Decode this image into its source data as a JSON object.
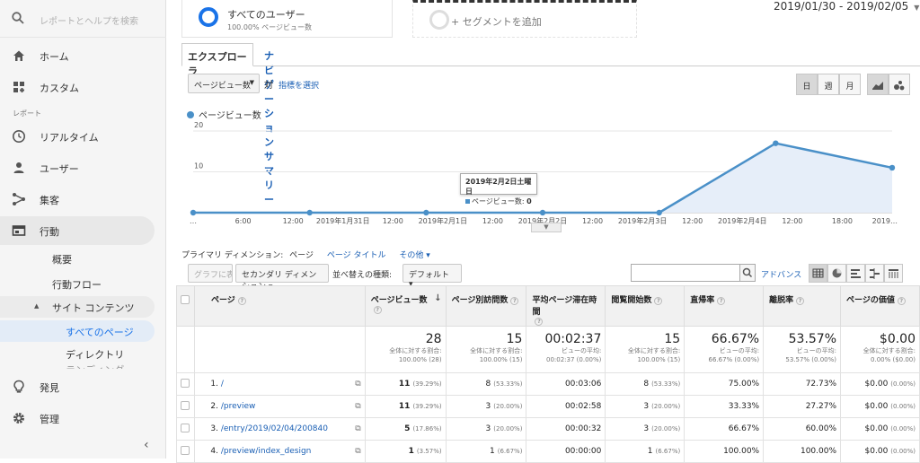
{
  "sidebar": {
    "search_placeholder": "レポートとヘルプを検索",
    "home": "ホーム",
    "custom": "カスタム",
    "reports_label": "レポート",
    "realtime": "リアルタイム",
    "users": "ユーザー",
    "acquisition": "集客",
    "behavior": "行動",
    "overview": "概要",
    "behavior_flow": "行動フロー",
    "site_content": "サイト コンテンツ",
    "site_content_arrow": "▲",
    "all_pages": "すべてのページ",
    "directory": "ディレクトリ",
    "landing_pages_cut": "ランディング",
    "discover": "発見",
    "admin": "管理",
    "collapse_glyph": "‹"
  },
  "segments": {
    "seg1_title": "すべてのユーザー",
    "seg1_sub": "100.00% ページビュー数",
    "seg2_title": "+ セグメントを追加"
  },
  "date_range": "2019/01/30 - 2019/02/05",
  "tabs": {
    "explorer": "エクスプローラ",
    "nav_summary": "ナビゲーション サマリー"
  },
  "controls": {
    "metric_select": "ページビュー数",
    "vs": "対",
    "pick_metric": "指標を選択",
    "day": "日",
    "week": "週",
    "month": "月"
  },
  "chart_data": {
    "type": "area",
    "legend": "ページビュー数",
    "ylim": [
      0,
      20
    ],
    "yticks": [
      10,
      20
    ],
    "x_labels": [
      "…",
      "6:00",
      "12:00",
      "2019年1月31日",
      "12:00",
      "2019年2月1日",
      "12:00",
      "2019年2月2日",
      "12:00",
      "2019年2月3日",
      "12:00",
      "2019年2月4日",
      "12:00",
      "18:00",
      "2019…"
    ],
    "points": [
      {
        "x": "2019年1月30日",
        "y": 0
      },
      {
        "x": "2019年1月31日",
        "y": 0
      },
      {
        "x": "2019年2月1日",
        "y": 0
      },
      {
        "x": "2019年2月2日",
        "y": 0
      },
      {
        "x": "2019年2月3日",
        "y": 0
      },
      {
        "x": "2019年2月4日",
        "y": 17
      },
      {
        "x": "2019年2月5日",
        "y": 11
      }
    ],
    "color": "#4a90c8",
    "grid": true,
    "tooltip": {
      "title": "2019年2月2日土曜日",
      "label": "ページビュー数:",
      "value": "0"
    }
  },
  "dimension": {
    "label": "プライマリ ディメンション:",
    "current": "ページ",
    "page_title": "ページ タイトル",
    "other": "その他 ▾"
  },
  "toolbar": {
    "plot_rows": "グラフに表示",
    "secondary_dim": "セカンダリ ディメンション ▾",
    "sort_label": "並べ替えの種類:",
    "sort_value": "デフォルト ▾",
    "advanced": "アドバンス"
  },
  "table": {
    "headers": [
      "ページ",
      "ページビュー数",
      "ページ別訪問数",
      "平均ページ滞在時間",
      "閲覧開始数",
      "直帰率",
      "離脱率",
      "ページの価値"
    ],
    "totals": [
      {
        "value": "28",
        "l1": "全体に対する割合:",
        "l2": "100.00% (28)"
      },
      {
        "value": "15",
        "l1": "全体に対する割合:",
        "l2": "100.00% (15)"
      },
      {
        "value": "00:02:37",
        "l1": "ビューの平均:",
        "l2": "00:02:37 (0.00%)"
      },
      {
        "value": "15",
        "l1": "全体に対する割合:",
        "l2": "100.00% (15)"
      },
      {
        "value": "66.67%",
        "l1": "ビューの平均:",
        "l2": "66.67% (0.00%)"
      },
      {
        "value": "53.57%",
        "l1": "ビューの平均:",
        "l2": "53.57% (0.00%)"
      },
      {
        "value": "$0.00",
        "l1": "全体に対する割合:",
        "l2": "0.00% ($0.00)"
      }
    ],
    "rows": [
      {
        "idx": "1.",
        "page": "/",
        "pv": "11",
        "pv_pct": "(39.29%)",
        "uv": "8",
        "uv_pct": "(53.33%)",
        "avg": "00:03:06",
        "ent": "8",
        "ent_pct": "(53.33%)",
        "bounce": "75.00%",
        "exit": "72.73%",
        "val": "$0.00",
        "val_pct": "(0.00%)"
      },
      {
        "idx": "2.",
        "page": "/preview",
        "pv": "11",
        "pv_pct": "(39.29%)",
        "uv": "3",
        "uv_pct": "(20.00%)",
        "avg": "00:02:58",
        "ent": "3",
        "ent_pct": "(20.00%)",
        "bounce": "33.33%",
        "exit": "27.27%",
        "val": "$0.00",
        "val_pct": "(0.00%)"
      },
      {
        "idx": "3.",
        "page": "/entry/2019/02/04/200840",
        "pv": "5",
        "pv_pct": "(17.86%)",
        "uv": "3",
        "uv_pct": "(20.00%)",
        "avg": "00:00:32",
        "ent": "3",
        "ent_pct": "(20.00%)",
        "bounce": "66.67%",
        "exit": "60.00%",
        "val": "$0.00",
        "val_pct": "(0.00%)"
      },
      {
        "idx": "4.",
        "page": "/preview/index_design",
        "pv": "1",
        "pv_pct": "(3.57%)",
        "uv": "1",
        "uv_pct": "(6.67%)",
        "avg": "00:00:00",
        "ent": "1",
        "ent_pct": "(6.67%)",
        "bounce": "100.00%",
        "exit": "100.00%",
        "val": "$0.00",
        "val_pct": "(0.00%)"
      }
    ]
  }
}
